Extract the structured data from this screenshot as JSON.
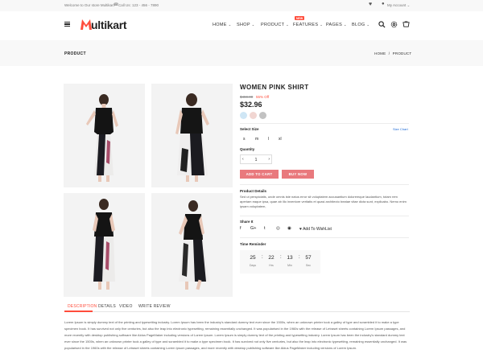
{
  "topbar": {
    "welcome": "Welcome to Our store Multikart",
    "call": "Call Us: 123 - 456 - 7890",
    "account": "My Account",
    "account_chevron": "⌄"
  },
  "header": {
    "logo_text": "ultikart",
    "nav": [
      "HOME",
      "SHOP",
      "PRODUCT",
      "FEATURES",
      "PAGES",
      "BLOG"
    ],
    "new_badge": "NEW",
    "chevron": "⌄"
  },
  "breadcrumb": {
    "title": "PRODUCT",
    "home": "HOME",
    "separator": "/",
    "current": "PRODUCT"
  },
  "product": {
    "name": "WOMEN PINK SHIRT",
    "old_price": "$459.00",
    "discount": "55% Off",
    "price": "$32.96",
    "swatches": [
      "#cfe6f5",
      "#f1d6d2",
      "#c2c2c2"
    ],
    "select_size_label": "Select Size",
    "size_chart": "Size Chart",
    "sizes": [
      "s",
      "m",
      "l",
      "xl"
    ],
    "quantity_label": "Quantity",
    "quantity": "1",
    "qty_minus": "‹",
    "qty_plus": "›",
    "add_to_cart": "ADD TO CART",
    "buy_now": "BUY NOW",
    "details_label": "Product Details",
    "details_text": "Sed ut perspiciatis, unde omnis iste natus error sit voluptatem accusantium doloremque laudantium, totam rem aperiam eaque ipsa, quae ab illo inventore veritatis et quasi architecto beatae vitae dicta sunt, explicabo. Nemo enim ipsam voluptatem,",
    "share_label": "Share It",
    "share_icons": [
      "f",
      "G+",
      "t",
      "◎",
      "◉"
    ],
    "wishlist": "Add To WishList",
    "timer_label": "Time Reminder",
    "timer": [
      {
        "value": "25",
        "unit": "Days"
      },
      {
        "value": "22",
        "unit": "Hrs"
      },
      {
        "value": "13",
        "unit": "Min"
      },
      {
        "value": "57",
        "unit": "Sec"
      }
    ],
    "timer_sep": ":"
  },
  "tabs": [
    "DESCRIPTION",
    "DETAILS",
    "VIDEO",
    "WRITE REVIEW"
  ],
  "description": "Lorem Ipsum is simply dummy text of the printing and typesetting industry. Lorem Ipsum has been the industry's standard dummy text ever since the 1500s, when an unknown printer took a galley of type and scrambled it to make a type specimen book. It has survived not only five centuries, but also the leap into electronic typesetting, remaining essentially unchanged. It was popularised in the 1960s with the release of Letraset sheets containing Lorem Ipsum passages, and more recently with desktop publishing software like Aldus PageMaker including versions of Lorem Ipsum. Lorem Ipsum is simply dummy text of the printing and typesetting industry. Lorem Ipsum has been the industry's standard dummy text ever since the 1500s, when an unknown printer took a galley of type and scrambled it to make a type specimen book. It has survived not only five centuries, but also the leap into electronic typesetting, remaining essentially unchanged. It was popularised in the 1960s with the release of Letraset sheets containing Lorem Ipsum passages, and more recently with desktop publishing software like Aldus PageMaker including versions of Lorem Ipsum.",
  "colors": {
    "accent": "#ff4c3b",
    "button": "#e9797d",
    "link": "#1e6ad6"
  }
}
